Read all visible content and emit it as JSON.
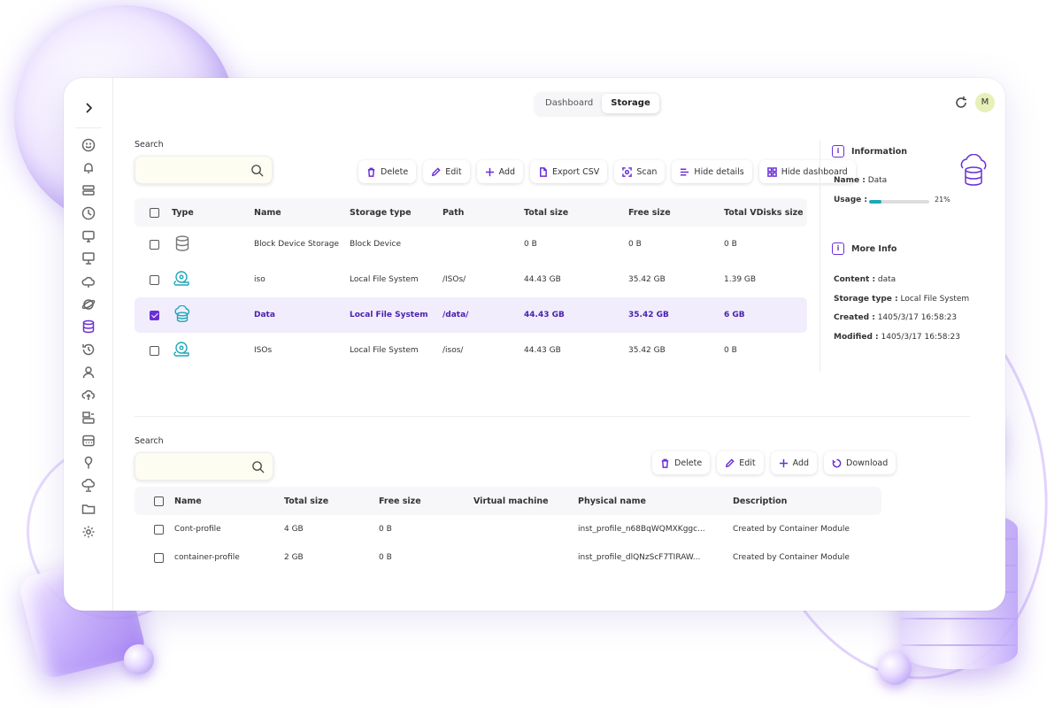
{
  "topbar": {
    "tabs": [
      {
        "label": "Dashboard",
        "active": false
      },
      {
        "label": "Storage",
        "active": true
      }
    ],
    "avatar_letter": "M"
  },
  "sidebar": {
    "items": [
      "smile-icon",
      "bell-icon",
      "server-icon",
      "clock-icon",
      "monitor-icon",
      "desktop-icon",
      "cloud-icon",
      "planet-icon",
      "database-icon",
      "history-icon",
      "user-icon",
      "cloud-upload-icon",
      "network-server-icon",
      "rack-icon",
      "probe-icon",
      "cloud-monitor-icon",
      "folder-icon",
      "gear-icon"
    ],
    "active_index": 8
  },
  "storage": {
    "search_label": "Search",
    "search_placeholder": "",
    "toolbar": [
      "Delete",
      "Edit",
      "Add",
      "Export CSV",
      "Scan",
      "Hide details",
      "Hide dashboard"
    ],
    "columns": [
      "Type",
      "Name",
      "Storage type",
      "Path",
      "Total size",
      "Free size",
      "Total VDisks size"
    ],
    "rows": [
      {
        "type_icon": "database-icon",
        "name": "Block Device Storage",
        "storage_type": "Block Device",
        "path": "",
        "total": "0 B",
        "free": "0 B",
        "vdisks": "0 B",
        "checked": false
      },
      {
        "type_icon": "disk-iso-icon",
        "name": "iso",
        "storage_type": "Local File System",
        "path": "/ISOs/",
        "total": "44.43 GB",
        "free": "35.42 GB",
        "vdisks": "1.39 GB",
        "checked": false
      },
      {
        "type_icon": "cloud-storage-icon",
        "name": "Data",
        "storage_type": "Local File System",
        "path": "/data/",
        "total": "44.43 GB",
        "free": "35.42 GB",
        "vdisks": "6 GB",
        "checked": true
      },
      {
        "type_icon": "disk-iso-icon",
        "name": "ISOs",
        "storage_type": "Local File System",
        "path": "/isos/",
        "total": "44.43 GB",
        "free": "35.42 GB",
        "vdisks": "0 B",
        "checked": false
      }
    ]
  },
  "information": {
    "title": "Information",
    "name_label": "Name :",
    "name_value": "Data",
    "usage_label": "Usage :",
    "usage_percent": 21,
    "usage_text": "21%"
  },
  "more_info": {
    "title": "More Info",
    "content_label": "Content :",
    "content_value": "data",
    "storage_type_label": "Storage type :",
    "storage_type_value": "Local File System",
    "created_label": "Created :",
    "created_value": "1405/3/17 16:58:23",
    "modified_label": "Modified :",
    "modified_value": "1405/3/17 16:58:23"
  },
  "profiles": {
    "search_label": "Search",
    "search_placeholder": "",
    "toolbar": [
      "Delete",
      "Edit",
      "Add",
      "Download"
    ],
    "columns": [
      "Name",
      "Total size",
      "Free size",
      "Virtual machine",
      "Physical name",
      "Description"
    ],
    "rows": [
      {
        "name": "Cont-profile",
        "total": "4 GB",
        "free": "0 B",
        "vm": "",
        "physical": "inst_profile_n68BqWQMXKggc...",
        "description": "Created by Container Module"
      },
      {
        "name": "container-profile",
        "total": "2 GB",
        "free": "0 B",
        "vm": "",
        "physical": "inst_profile_dlQNzScF7TIRAW...",
        "description": "Created by Container Module"
      }
    ]
  },
  "colors": {
    "accent": "#6a2fd6",
    "teal": "#1ea7b8",
    "selected_row": "#f1edfc"
  }
}
